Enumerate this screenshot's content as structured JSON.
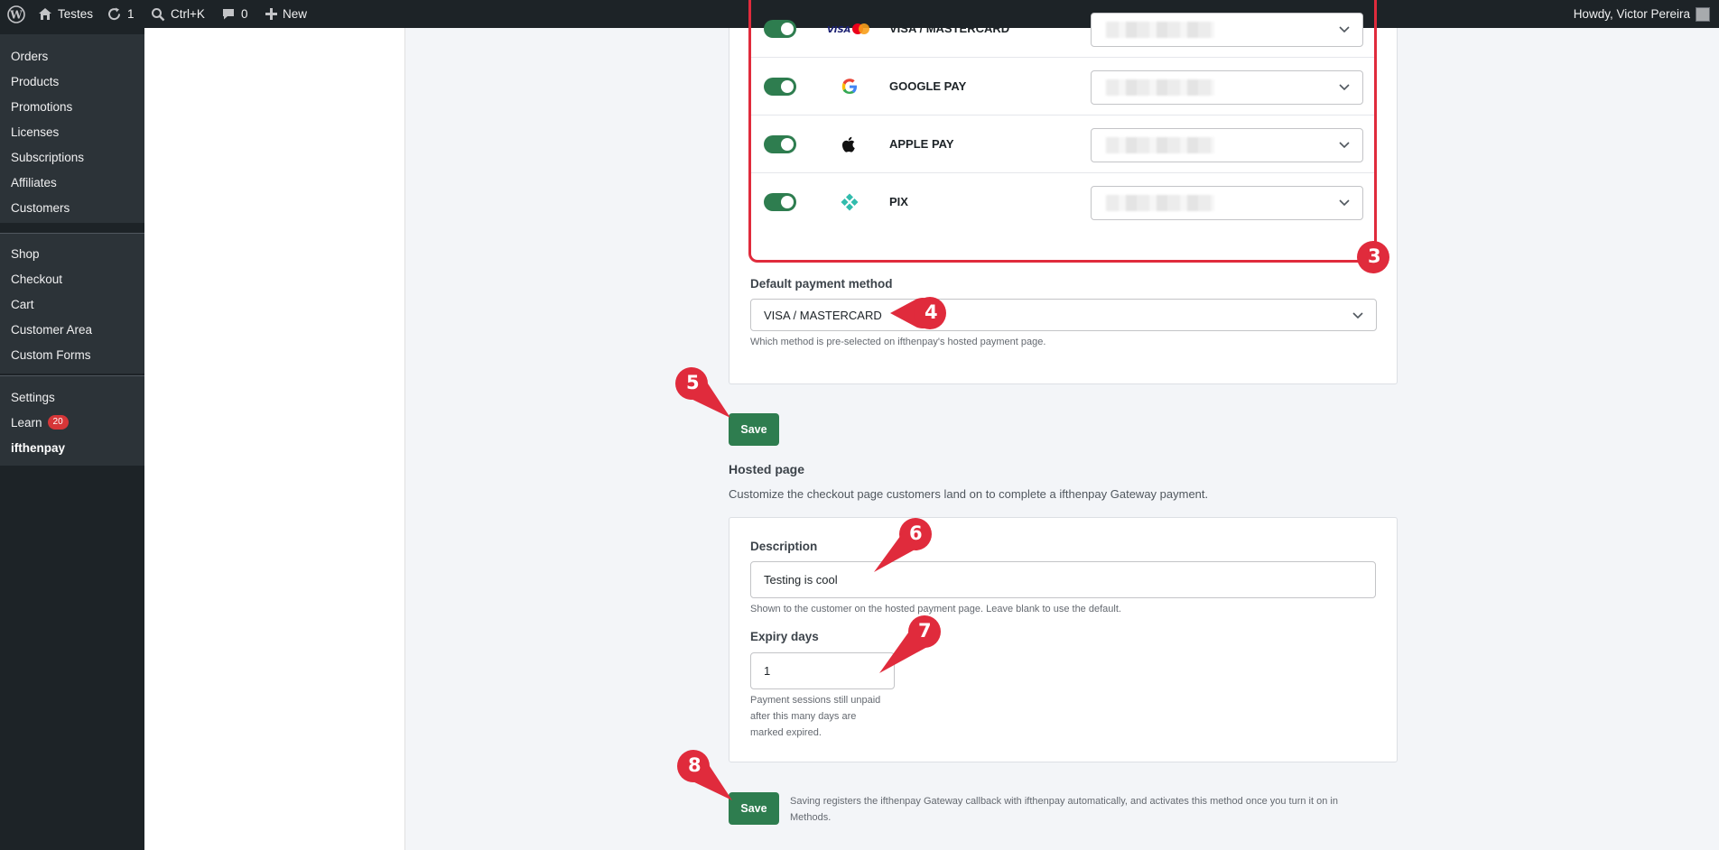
{
  "adminbar": {
    "site_name": "Testes",
    "updates_count": "1",
    "search_shortcut": "Ctrl+K",
    "comments_count": "0",
    "new_label": "New",
    "greeting": "Howdy, Victor Pereira"
  },
  "sidebar": {
    "group1": [
      "Orders",
      "Products",
      "Promotions",
      "Licenses",
      "Subscriptions",
      "Affiliates",
      "Customers"
    ],
    "group2": [
      "Shop",
      "Checkout",
      "Cart",
      "Customer Area",
      "Custom Forms"
    ],
    "group3": {
      "settings": "Settings",
      "learn": "Learn",
      "learn_badge": "20",
      "current": "ifthenpay"
    }
  },
  "methods": [
    {
      "name": "VISA / MASTERCARD",
      "icon": "visa-mastercard-icon",
      "enabled": true
    },
    {
      "name": "GOOGLE PAY",
      "icon": "google-icon",
      "enabled": true
    },
    {
      "name": "APPLE PAY",
      "icon": "apple-icon",
      "enabled": true
    },
    {
      "name": "PIX",
      "icon": "pix-icon",
      "enabled": true
    }
  ],
  "default_method": {
    "label": "Default payment method",
    "value": "VISA / MASTERCARD",
    "help": "Which method is pre-selected on ifthenpay's hosted payment page."
  },
  "save_label": "Save",
  "hosted_page": {
    "title": "Hosted page",
    "description": "Customize the checkout page customers land on to complete a ifthenpay Gateway payment.",
    "desc_label": "Description",
    "desc_value": "Testing is cool",
    "desc_help": "Shown to the customer on the hosted payment page. Leave blank to use the default.",
    "expiry_label": "Expiry days",
    "expiry_value": "1",
    "expiry_help_1": "Payment sessions still unpaid",
    "expiry_help_2": "after this many days are",
    "expiry_help_3": "marked expired."
  },
  "footer_note_1": "Saving registers the ifthenpay Gateway callback with ifthenpay automatically, and activates this method once you turn it on in",
  "footer_note_2": "Methods.",
  "callouts": [
    "3",
    "4",
    "5",
    "6",
    "7",
    "8"
  ],
  "colors": {
    "accent": "#2e7d4f",
    "callout": "#e02b3c",
    "adminbar": "#1d2327"
  }
}
